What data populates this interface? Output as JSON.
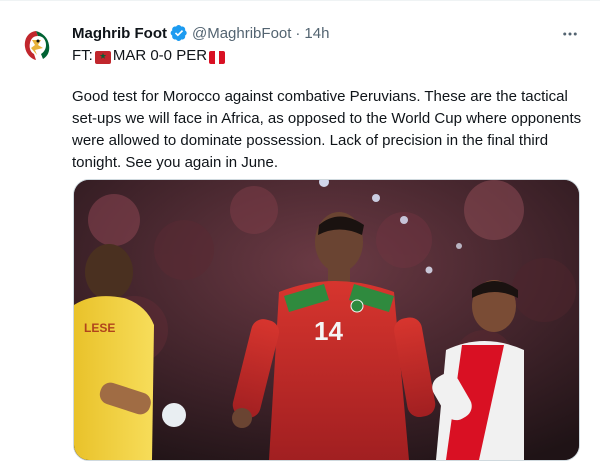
{
  "tweet": {
    "display_name": "Maghrib Foot",
    "handle": "@MaghribFoot",
    "separator": "·",
    "time": "14h",
    "more_label": "···",
    "line1": {
      "prefix": "FT: ",
      "team1": "MAR 0-0 PER"
    },
    "body": "Good test for Morocco against combative Peruvians. These are the tactical set-ups we will face in Africa, as opposed to the World Cup where opponents were allowed to dominate possession. Lack of precision in the final third tonight. See you again in June."
  },
  "media": {
    "player_number": "14",
    "keeper_shirt_text": "LESE"
  },
  "colors": {
    "verified_blue": "#1d9bf0",
    "morocco_red": "#c1272d",
    "morocco_green": "#006233",
    "peru_red": "#d91023",
    "keeper_yellow": "#f5d033"
  }
}
